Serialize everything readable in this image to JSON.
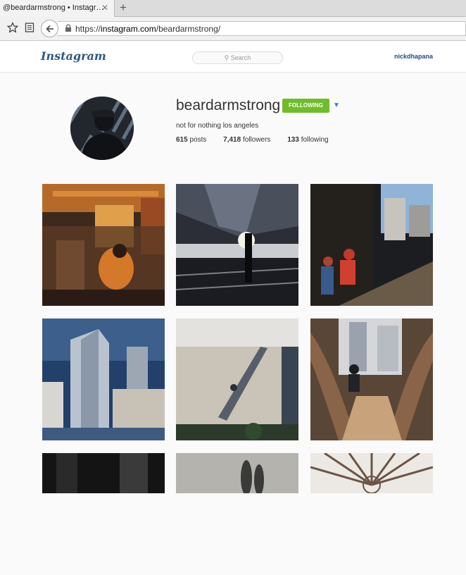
{
  "browser": {
    "tab_title": "@beardarmstrong • Instagr…",
    "tab_close": "✕",
    "new_tab": "+",
    "url_prefix": "https://",
    "url_domain": "instagram.com",
    "url_path": "/beardarmstrong/"
  },
  "header": {
    "logo": "Instagram",
    "search_placeholder": "Search",
    "search_glyph": "⚲",
    "current_user": "nickdhapana"
  },
  "profile": {
    "username": "beardarmstrong",
    "follow_label": "FOLLOWING",
    "dropdown_glyph": "▼",
    "bio": "not for nothing los angeles",
    "posts_count": "615",
    "posts_label": "posts",
    "followers_count": "7,418",
    "followers_label": "followers",
    "following_count": "133",
    "following_label": "following"
  },
  "colors": {
    "follow_green": "#6fbd2a",
    "link_blue": "#204a87",
    "logo_blue": "#2c5a85"
  },
  "icons": {
    "bookmark": "star-icon",
    "reading_list": "reading-list-icon",
    "back": "back-arrow-icon",
    "lock": "lock-icon"
  }
}
